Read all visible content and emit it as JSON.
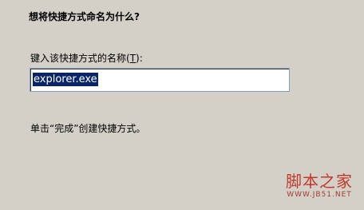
{
  "dialog": {
    "title": "想将快捷方式命名为什么?",
    "field_label_prefix": "键入该快捷方式的名称(",
    "field_label_accesskey": "T",
    "field_label_suffix": "):",
    "name_value": "explorer.exe",
    "hint": "单击“完成”创建快捷方式。"
  },
  "watermark": {
    "main": "脚本之家",
    "sub": "WWW.JB51.NET"
  },
  "colors": {
    "background": "#d4d0c8",
    "selection": "#0a246a",
    "watermark": "#c0392b"
  }
}
